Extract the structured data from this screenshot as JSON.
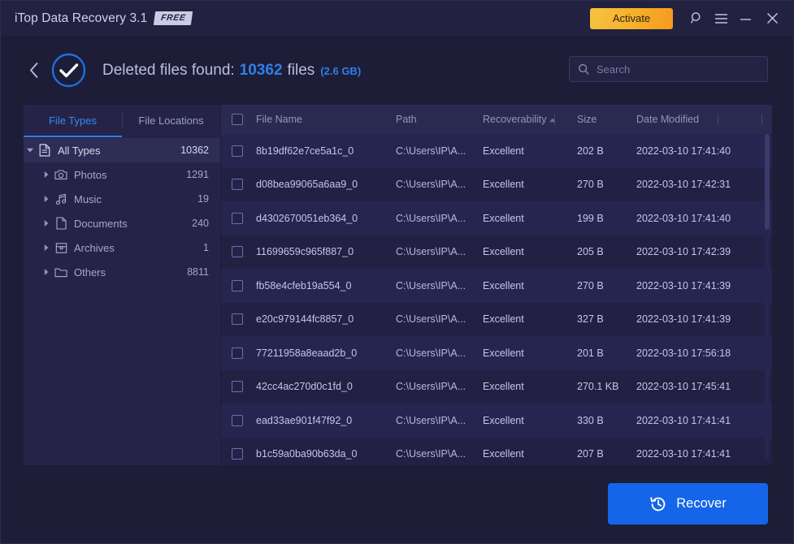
{
  "window": {
    "app_title": "iTop Data Recovery 3.1",
    "badge": "FREE",
    "activate_label": "Activate",
    "icons": {
      "search": "search-icon",
      "menu": "hamburger-menu-icon",
      "minimize": "minimize-icon",
      "close": "close-icon"
    }
  },
  "header": {
    "back": "back-chevron-icon",
    "status_icon": "check-circle-icon",
    "title_prefix": "Deleted files found:",
    "count": "10362",
    "unit": "files",
    "size": "(2.6 GB)"
  },
  "search": {
    "placeholder": "Search",
    "value": ""
  },
  "sidebar": {
    "tabs": [
      {
        "label": "File Types",
        "active": true
      },
      {
        "label": "File Locations",
        "active": false
      }
    ],
    "tree": [
      {
        "label": "All Types",
        "count": "10362",
        "icon": "document-icon",
        "root": true,
        "expanded": true
      },
      {
        "label": "Photos",
        "count": "1291",
        "icon": "camera-icon",
        "root": false,
        "expanded": false
      },
      {
        "label": "Music",
        "count": "19",
        "icon": "music-note-icon",
        "root": false,
        "expanded": false
      },
      {
        "label": "Documents",
        "count": "240",
        "icon": "page-icon",
        "root": false,
        "expanded": false
      },
      {
        "label": "Archives",
        "count": "1",
        "icon": "archive-icon",
        "root": false,
        "expanded": false
      },
      {
        "label": "Others",
        "count": "8811",
        "icon": "folder-icon",
        "root": false,
        "expanded": false
      }
    ]
  },
  "table": {
    "columns": [
      "File Name",
      "Path",
      "Recoverability",
      "Size",
      "Date Modified"
    ],
    "sorted_column": "Recoverability",
    "sort_direction": "asc",
    "header_checkbox_checked": false,
    "rows": [
      {
        "name": "8b19df62e7ce5a1c_0",
        "path": "C:\\Users\\IP\\A...",
        "recoverability": "Excellent",
        "size": "202 B",
        "date": "2022-03-10 17:41:40",
        "checked": false
      },
      {
        "name": "d08bea99065a6aa9_0",
        "path": "C:\\Users\\IP\\A...",
        "recoverability": "Excellent",
        "size": "270 B",
        "date": "2022-03-10 17:42:31",
        "checked": false
      },
      {
        "name": "d4302670051eb364_0",
        "path": "C:\\Users\\IP\\A...",
        "recoverability": "Excellent",
        "size": "199 B",
        "date": "2022-03-10 17:41:40",
        "checked": false
      },
      {
        "name": "11699659c965f887_0",
        "path": "C:\\Users\\IP\\A...",
        "recoverability": "Excellent",
        "size": "205 B",
        "date": "2022-03-10 17:42:39",
        "checked": false
      },
      {
        "name": "fb58e4cfeb19a554_0",
        "path": "C:\\Users\\IP\\A...",
        "recoverability": "Excellent",
        "size": "270 B",
        "date": "2022-03-10 17:41:39",
        "checked": false
      },
      {
        "name": "e20c979144fc8857_0",
        "path": "C:\\Users\\IP\\A...",
        "recoverability": "Excellent",
        "size": "327 B",
        "date": "2022-03-10 17:41:39",
        "checked": false
      },
      {
        "name": "77211958a8eaad2b_0",
        "path": "C:\\Users\\IP\\A...",
        "recoverability": "Excellent",
        "size": "201 B",
        "date": "2022-03-10 17:56:18",
        "checked": false
      },
      {
        "name": "42cc4ac270d0c1fd_0",
        "path": "C:\\Users\\IP\\A...",
        "recoverability": "Excellent",
        "size": "270.1 KB",
        "date": "2022-03-10 17:45:41",
        "checked": false
      },
      {
        "name": "ead33ae901f47f92_0",
        "path": "C:\\Users\\IP\\A...",
        "recoverability": "Excellent",
        "size": "330 B",
        "date": "2022-03-10 17:41:41",
        "checked": false
      },
      {
        "name": "b1c59a0ba90b63da_0",
        "path": "C:\\Users\\IP\\A...",
        "recoverability": "Excellent",
        "size": "207 B",
        "date": "2022-03-10 17:41:41",
        "checked": false
      }
    ]
  },
  "footer": {
    "recover_label": "Recover",
    "recover_icon": "clock-rewind-icon"
  },
  "colors": {
    "accent_blue": "#2f7fe8",
    "recover_blue": "#1565e8",
    "activate_orange": "#f7a827",
    "window_bg": "#1d1d38",
    "panel_bg": "#242345",
    "sidebar_bg": "#252448"
  }
}
